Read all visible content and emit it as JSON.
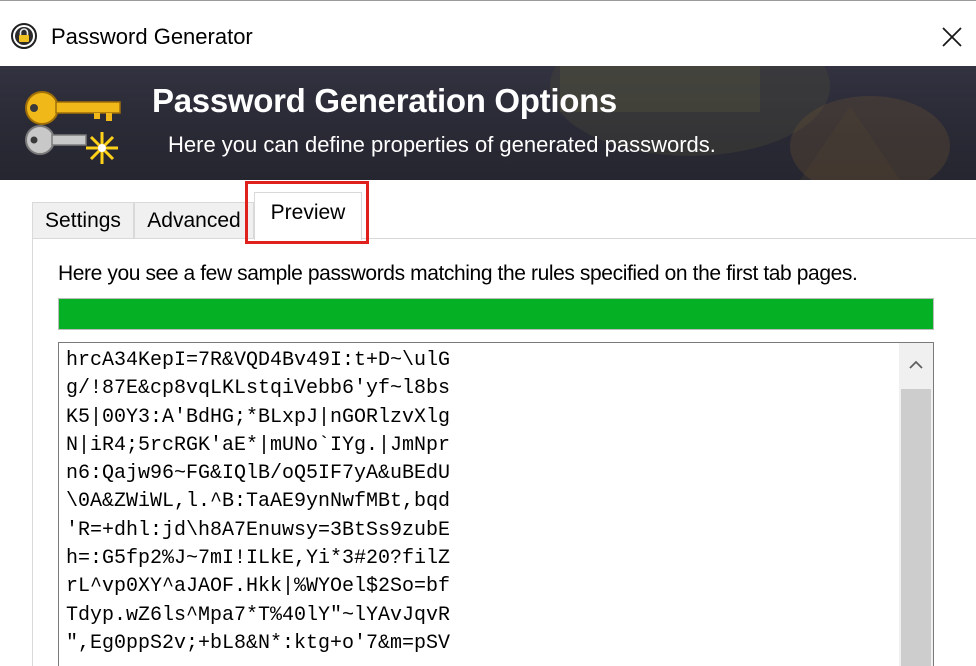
{
  "window": {
    "title": "Password Generator",
    "icon": "lock-icon",
    "close_icon": "close-icon"
  },
  "banner": {
    "title": "Password Generation Options",
    "subtitle": "Here you can define properties of generated passwords.",
    "icon": "keys-icon"
  },
  "tabs": [
    {
      "label": "Settings",
      "active": false
    },
    {
      "label": "Advanced",
      "active": false
    },
    {
      "label": "Preview",
      "active": true
    }
  ],
  "preview": {
    "description": "Here you see a few sample passwords matching the rules specified on the first tab pages.",
    "progress_percent": 100,
    "passwords": [
      "hrcA34KepI=7R&VQD4Bv49I:t+D~\\ulG",
      "g/!87E&cp8vqLKLstqiVebb6'yf~l8bs",
      "K5|00Y3:A'BdHG;*BLxpJ|nGORlzvXlg",
      "N|iR4;5rcRGK'aE*|mUNo`IYg.|JmNpr",
      "n6:Qajw96~FG&IQlB/oQ5IF7yA&uBEdU",
      "\\0A&ZWiWL,l.^B:TaAE9ynNwfMBt,bqd",
      "'R=+dhl:jd\\h8A7Enuwsy=3BtSs9zubE",
      "h=:G5fp2%J~7mI!ILkE,Yi*3#20?filZ",
      "rL^vp0XY^aJAOF.Hkk|%WYOel$2So=bf",
      "Tdyp.wZ6ls^Mpa7*T%40lY\"~lYAvJqvR",
      "\",Eg0ppS2v;+bL8&N*:ktg+o'7&m=pSV"
    ]
  },
  "colors": {
    "progress_fill": "#06b025",
    "highlight": "#e0201c",
    "banner_bg": "#2a2a36"
  }
}
